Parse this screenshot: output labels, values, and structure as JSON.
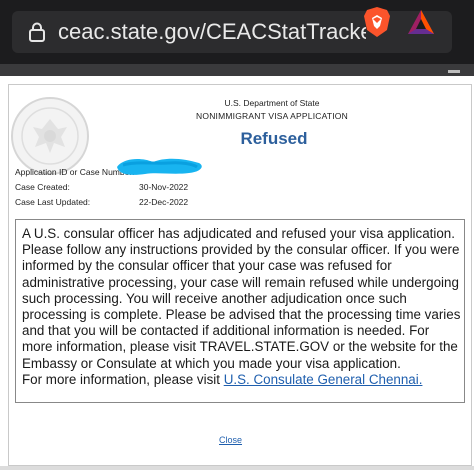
{
  "browser": {
    "url": "ceac.state.gov/CEACStatTracker/S",
    "lock_icon": "lock-icon",
    "extension_icons": [
      "brave-shields-icon",
      "bat-rewards-icon"
    ],
    "colors": {
      "chrome": "#1c1c1e",
      "urlbar": "#2c2c2e",
      "brave": "#fb542b"
    }
  },
  "header": {
    "department": "U.S. Department of State",
    "application_type": "NONIMMIGRANT VISA APPLICATION",
    "seal_icon": "us-department-of-state-seal-icon"
  },
  "status": {
    "label": "Refused",
    "color": "#2c5f9c"
  },
  "details": [
    {
      "label": "Application ID or Case Number:",
      "value": ""
    },
    {
      "label": "Case Created:",
      "value": "30-Nov-2022"
    },
    {
      "label": "Case Last Updated:",
      "value": "22-Dec-2022"
    }
  ],
  "message": {
    "body": "A U.S. consular officer has adjudicated and refused your visa application. Please follow any instructions provided by the consular officer. If you were informed by the consular officer that your case was refused for administrative processing, your case will remain refused while undergoing such processing. You will receive another adjudication once such processing is complete. Please be advised that the processing time varies and that you will be contacted if additional information is needed. For more information, please visit TRAVEL.STATE.GOV or the website for the Embassy or Consulate at which you made your visa application.",
    "more_info_prefix": "For more information, please visit ",
    "more_info_link": "U.S. Consulate General Chennai."
  },
  "footer": {
    "close_label": "Close"
  }
}
